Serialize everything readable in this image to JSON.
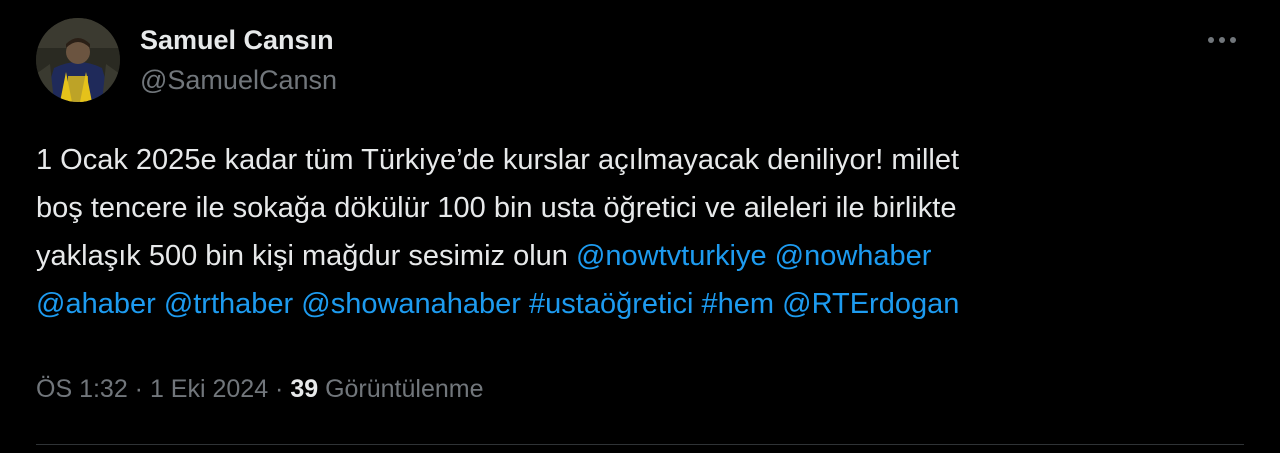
{
  "author": {
    "name": "Samuel Cansın",
    "handle": "@SamuelCansn"
  },
  "tweet": {
    "line1": "1 Ocak 2025e kadar tüm Türkiye’de kurslar açılmayacak deniliyor! millet",
    "line2": "boş tencere ile sokağa dökülür 100 bin usta öğretici ve aileleri ile birlikte",
    "line3_text": "yaklaşık 500 bin kişi mağdur sesimiz olun ",
    "mentions": {
      "nowtvturkiye": "@nowtvturkiye",
      "nowhaber": "@nowhaber",
      "ahaber": "@ahaber",
      "trthaber": "@trthaber",
      "showanahaber": "@showanahaber",
      "rterdogan": "@RTErdogan"
    },
    "hashtags": {
      "ustaogretici": "#ustaöğretici",
      "hem": "#hem"
    }
  },
  "meta": {
    "time": "ÖS 1:32",
    "separator": " · ",
    "date": "1 Eki 2024",
    "views_count": "39",
    "views_label": "Görüntülenme"
  },
  "icons": {
    "more": "more-horizontal-icon",
    "avatar": "avatar-photo"
  },
  "colors": {
    "background": "#000000",
    "text_primary": "#e7e9ea",
    "text_secondary": "#71767b",
    "link": "#1d9bf0",
    "divider": "#2f3336"
  }
}
